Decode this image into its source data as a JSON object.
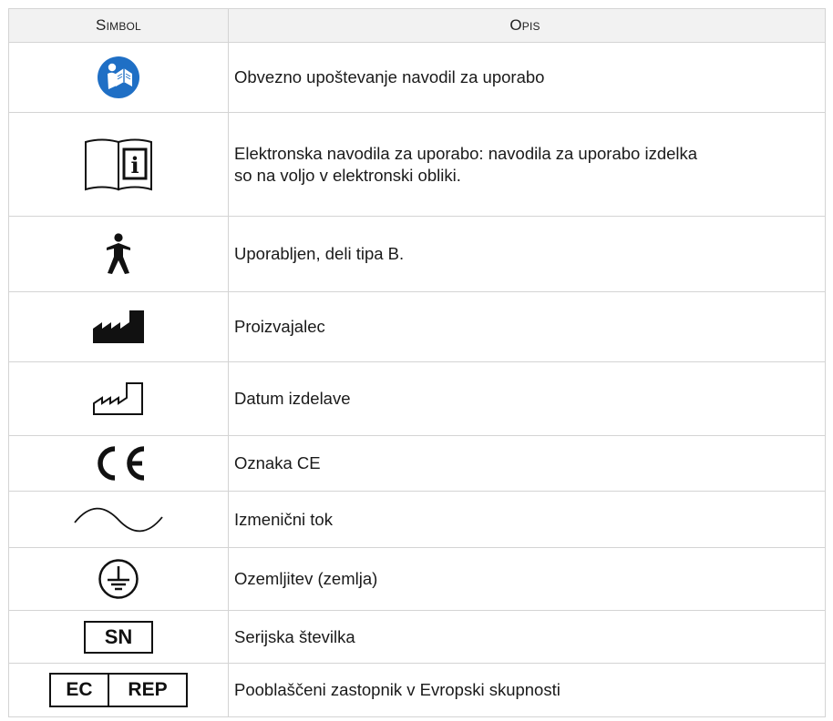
{
  "table": {
    "headers": {
      "symbol": "Simbol",
      "description": "Opis"
    },
    "rows": [
      {
        "icon": "read-instructions-icon",
        "description": "Obvezno upoštevanje navodil za uporabo"
      },
      {
        "icon": "electronic-ifu-icon",
        "description": "Elektronska navodila za uporabo: navodila za uporabo izdelka\nso na voljo v elektronski obliki."
      },
      {
        "icon": "type-b-applied-part-icon",
        "description": "Uporabljen, deli tipa B."
      },
      {
        "icon": "manufacturer-icon",
        "description": "Proizvajalec"
      },
      {
        "icon": "date-of-manufacture-icon",
        "description": "Datum izdelave"
      },
      {
        "icon": "ce-mark-icon",
        "text": "CE",
        "description": "Oznaka CE"
      },
      {
        "icon": "alternating-current-icon",
        "description": "Izmenični tok"
      },
      {
        "icon": "protective-earth-icon",
        "description": "Ozemljitev (zemlja)"
      },
      {
        "icon": "serial-number-icon",
        "text": "SN",
        "description": "Serijska številka"
      },
      {
        "icon": "ec-rep-icon",
        "text_left": "EC",
        "text_right": "REP",
        "description": "Pooblaščeni zastopnik v Evropski skupnosti"
      }
    ]
  },
  "colors": {
    "header_bg": "#f2f2f2",
    "border": "#d4d4d4",
    "mandatory_blue": "#1f6fc5",
    "icon_black": "#111111"
  }
}
